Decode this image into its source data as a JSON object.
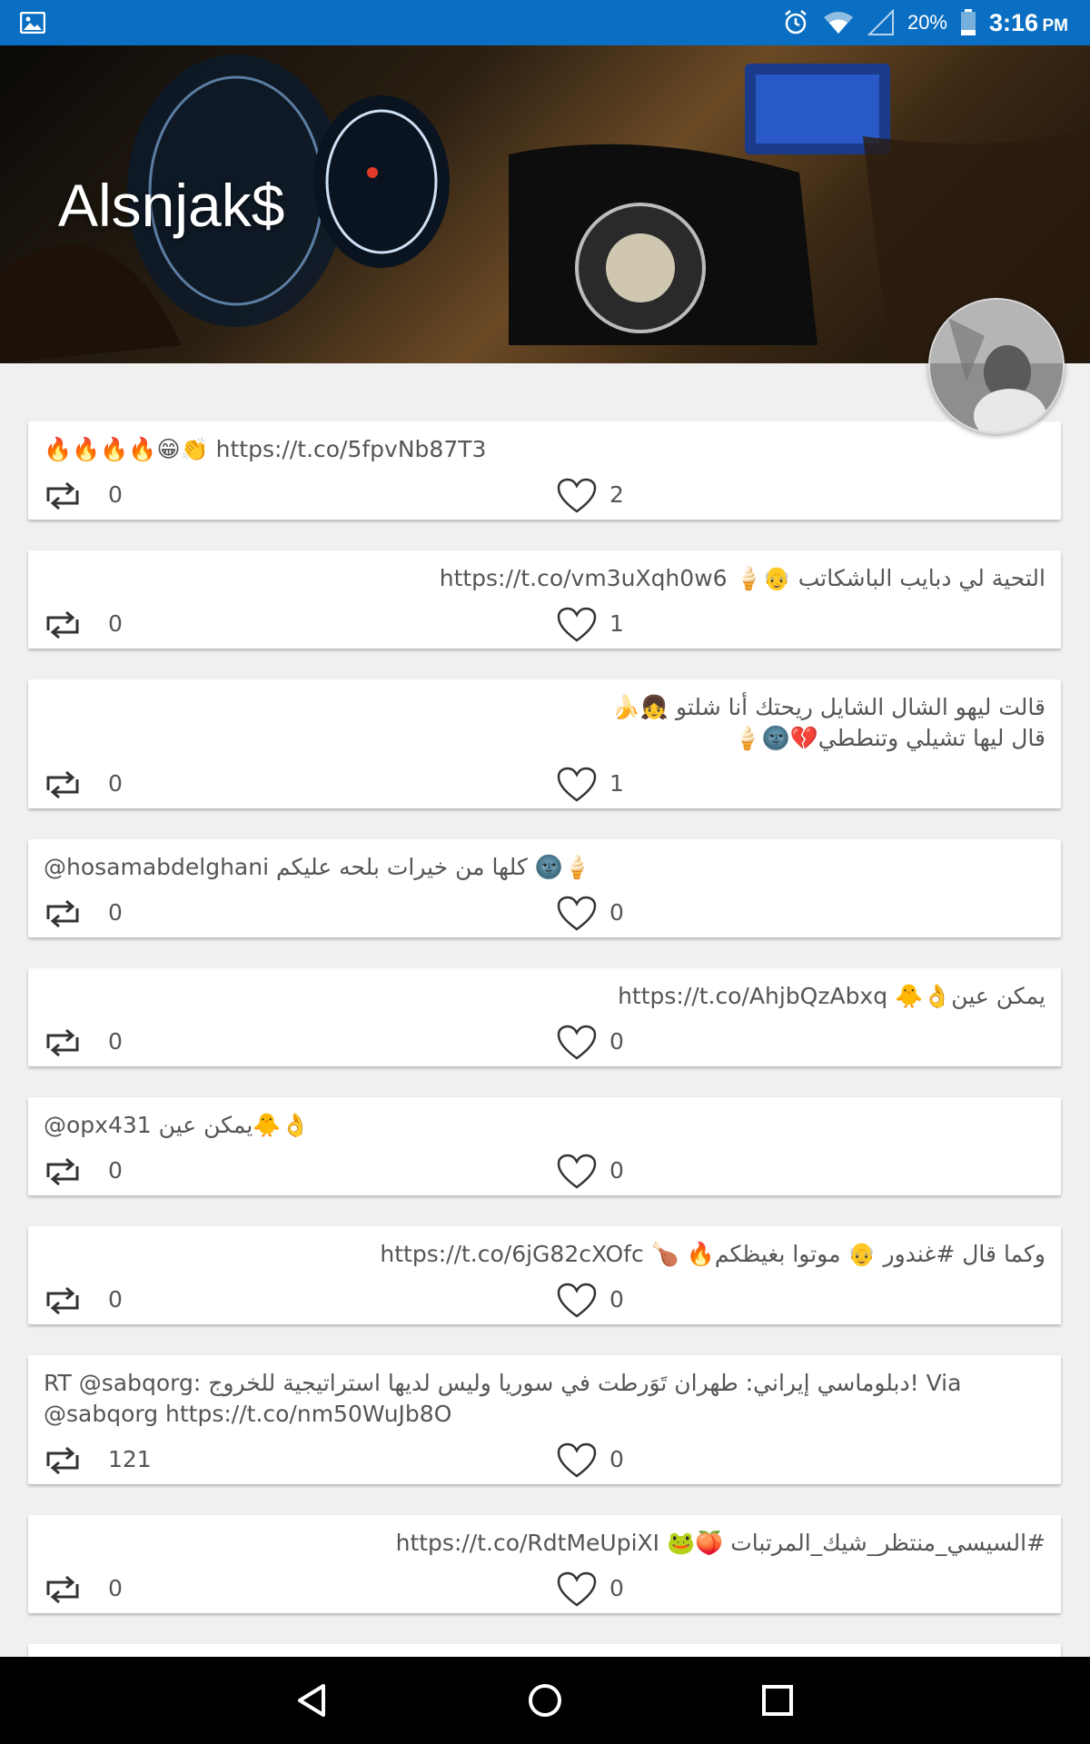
{
  "status_bar": {
    "battery_percent": "20%",
    "time": "3:16",
    "ampm": "PM",
    "background": "#0a6fc2",
    "icons": [
      "gallery-icon",
      "alarm-icon",
      "wifi-icon",
      "signal-icon",
      "battery-icon"
    ]
  },
  "profile": {
    "name": "Alsnjak$"
  },
  "tweets": [
    {
      "text": "🔥🔥🔥🔥😁👏 https://t.co/5fpvNb87T3",
      "retweets": "0",
      "likes": "2"
    },
    {
      "text": "التحية لي دبايب الباشكاتب 👴🍦 https://t.co/vm3uXqh0w6",
      "retweets": "0",
      "likes": "1"
    },
    {
      "text": "قالت ليهو الشال الشايل ريحتك أنا شلتو 👧🍌\nقال ليها تشيلي وتنططي💔🌚🍦",
      "retweets": "0",
      "likes": "1"
    },
    {
      "text": "@hosamabdelghani كلها من خيرات بلحه عليكم 🌚🍦",
      "retweets": "0",
      "likes": "0"
    },
    {
      "text": "يمكن عين👌🐥 https://t.co/AhjbQzAbxq",
      "retweets": "0",
      "likes": "0"
    },
    {
      "text": "@opx431 يمكن عين🐥👌",
      "retweets": "0",
      "likes": "0"
    },
    {
      "text": "وكما قال #غندور 👴 موتوا بغيظكم🔥 🍗 https://t.co/6jG82cXOfc",
      "retweets": "0",
      "likes": "0"
    },
    {
      "text": "RT @sabqorg: دبلوماسي إيراني: طهران تَوَرطت في سوريا وليس لديها استراتيجية للخروج! Via @sabqorg https://t.co/nm50WuJb8O",
      "retweets": "121",
      "likes": "0"
    },
    {
      "text": "#السيسي_منتظر_شيك_المرتبات 🍑🐸 https://t.co/RdtMeUpiXI",
      "retweets": "0",
      "likes": "0"
    }
  ],
  "nav_bar": {
    "icons": [
      "back-icon",
      "home-icon",
      "recents-icon"
    ]
  }
}
